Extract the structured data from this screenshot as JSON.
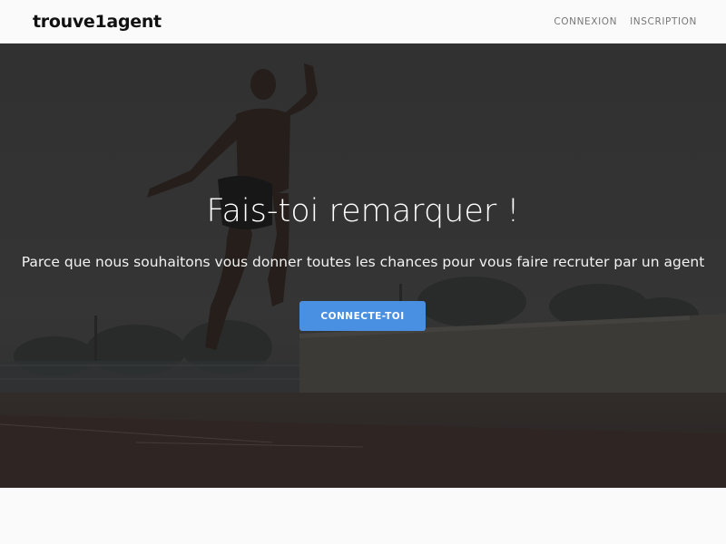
{
  "navbar": {
    "brand": "trouve1agent",
    "links": [
      {
        "label": "CONNEXION"
      },
      {
        "label": "INSCRIPTION"
      }
    ]
  },
  "hero": {
    "title": "Fais-toi remarquer !",
    "subtitle": "Parce que nous souhaitons vous donner toutes les chances pour vous faire recruter par un agent",
    "cta_label": "CONNECTE-TOI",
    "accent_color": "#4a90e2"
  }
}
